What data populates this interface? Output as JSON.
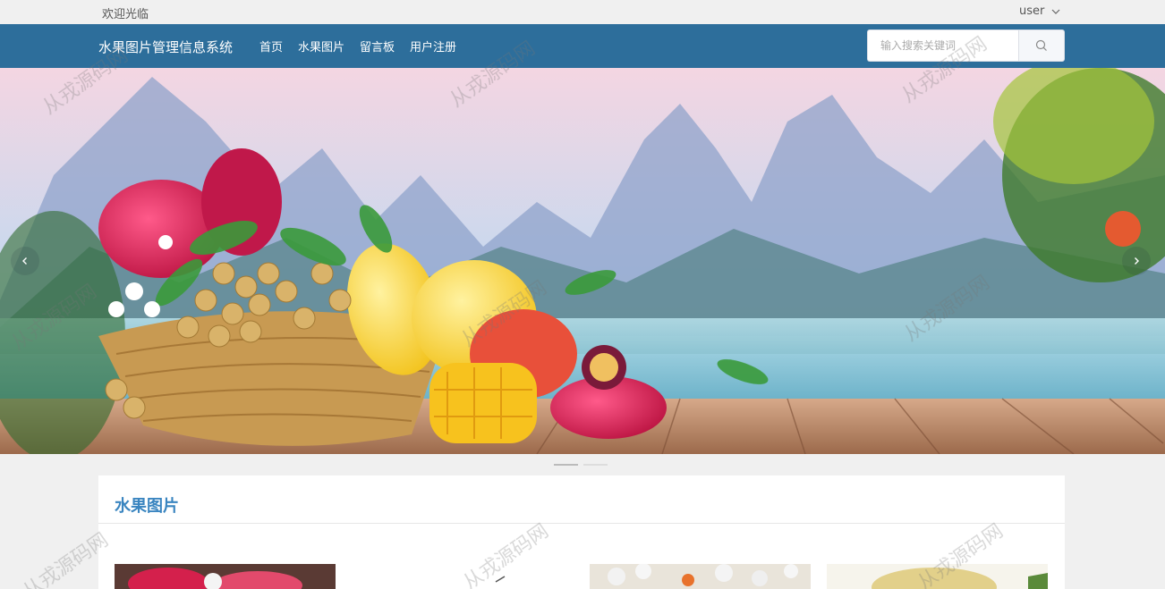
{
  "topbar": {
    "welcome": "欢迎光临",
    "user": "user"
  },
  "navbar": {
    "brand": "水果图片管理信息系统",
    "links": [
      "首页",
      "水果图片",
      "留言板",
      "用户注册"
    ],
    "search_placeholder": "输入搜索关键词"
  },
  "carousel": {
    "slide_count": 2,
    "active_index": 0
  },
  "section": {
    "title": "水果图片"
  },
  "watermark": "从戎源码网",
  "colors": {
    "navbar": "#2d6e9b",
    "accent": "#3a85c0"
  }
}
